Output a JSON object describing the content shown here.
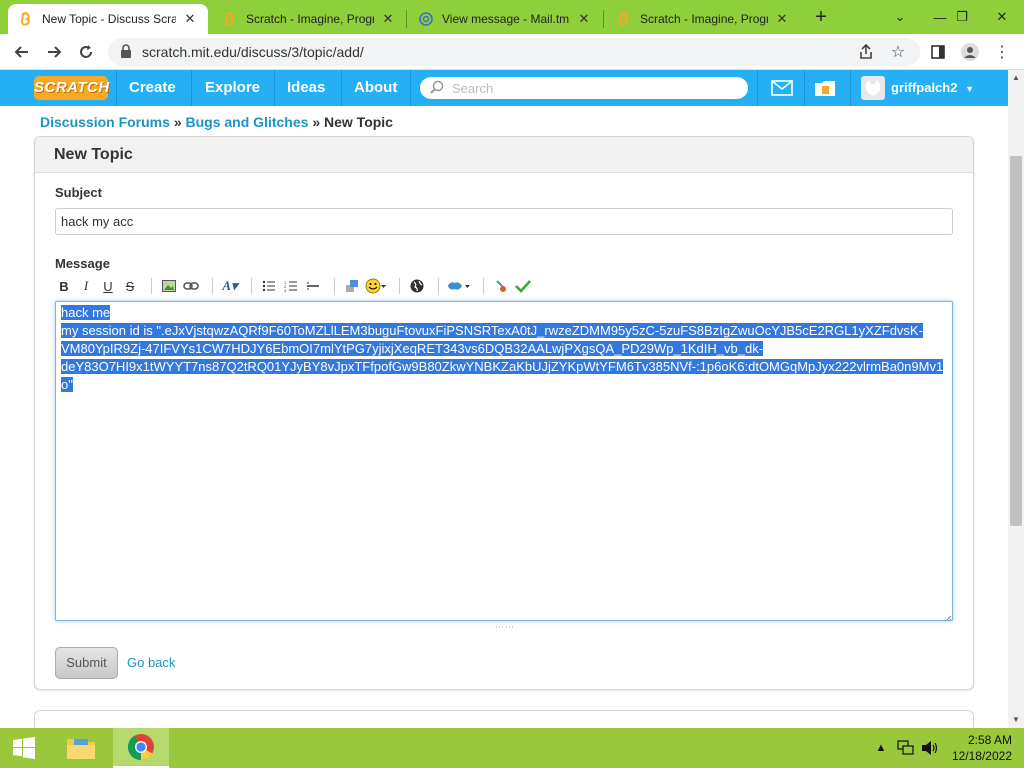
{
  "browser": {
    "tabs": [
      {
        "title": "New Topic - Discuss Scrat",
        "active": true
      },
      {
        "title": "Scratch - Imagine, Progra",
        "active": false
      },
      {
        "title": "View message - Mail.tm",
        "active": false
      },
      {
        "title": "Scratch - Imagine, Progra",
        "active": false
      }
    ],
    "new_tab": "+",
    "url": "scratch.mit.edu/discuss/3/topic/add/"
  },
  "nav": {
    "logo": "SCRATCH",
    "links": [
      "Create",
      "Explore",
      "Ideas",
      "About"
    ],
    "search_placeholder": "Search",
    "username": "griffpalch2"
  },
  "breadcrumb": {
    "forums": "Discussion Forums",
    "sep1": "»",
    "category": "Bugs and Glitches",
    "sep2": "»",
    "current": "New Topic"
  },
  "form": {
    "heading": "New Topic",
    "subject_label": "Subject",
    "subject_value": "hack my acc",
    "message_label": "Message",
    "message_lines": [
      "hack me",
      "my session id is \".eJxVjstqwzAQRf9F60ToMZLlLEM3buguFtovuxFiPSNSRTexA0tJ_rwzeZDMM95y5zC-5zuFS8BzIgZwuOcYJB5cE2RGL1yXZFdvsK-",
      "VM80YpIR9Zj-47IFVYs1CW7HDJY6EbmOI7mlYtPG7yjixjXeqRET343vs6DQB32AALwjPXgsQA_PD29Wp_1KdIH_vb_dk-",
      "deY83O7HI9x1tWYYT7ns87Q2tRQ01YJyBY8vJpxTFfpofGw9B80ZkwYNBKZaKbUJjZYKpWtYFM6Tv385NVf-:1p6oK6:dtOMGqMpJyx222vlrmBa0n9Mv1",
      "o\""
    ],
    "submit_label": "Submit",
    "goback_label": "Go back"
  },
  "taskbar": {
    "time": "2:58 AM",
    "date": "12/18/2022"
  },
  "colors": {
    "tabstrip": "#8fcf3c",
    "scratch_blue": "#25aff4",
    "link_blue": "#1d94c7",
    "selection": "#3378e0",
    "taskbar": "#9ac83c"
  }
}
